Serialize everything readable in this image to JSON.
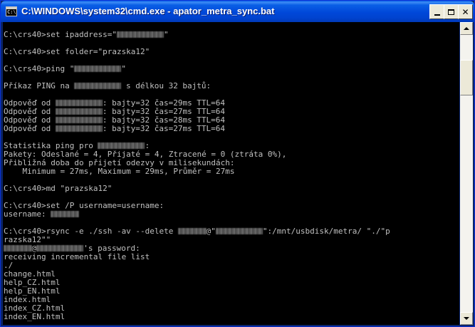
{
  "window": {
    "title": "C:\\WINDOWS\\system32\\cmd.exe - apator_metra_sync.bat",
    "app_icon": "cmd-console-icon",
    "buttons": {
      "minimize": "minimize-icon",
      "maximize": "maximize-icon",
      "close": "✕"
    }
  },
  "colors": {
    "console_bg": "#000000",
    "console_text": "#c0c0c0",
    "titlebar": "#0048d9"
  },
  "console": {
    "lines": [
      {
        "segs": []
      },
      {
        "segs": [
          {
            "t": "C:\\crs40>set ipaddress=\""
          },
          {
            "r": 10
          },
          {
            "t": "\""
          }
        ]
      },
      {
        "segs": []
      },
      {
        "segs": [
          {
            "t": "C:\\crs40>set folder=\"prazska12\""
          }
        ]
      },
      {
        "segs": []
      },
      {
        "segs": [
          {
            "t": "C:\\crs40>ping \""
          },
          {
            "r": 10
          },
          {
            "t": "\""
          }
        ]
      },
      {
        "segs": []
      },
      {
        "segs": [
          {
            "t": "Příkaz PING na "
          },
          {
            "r": 10
          },
          {
            "t": " s délkou 32 bajtů:"
          }
        ]
      },
      {
        "segs": []
      },
      {
        "segs": [
          {
            "t": "Odpověď od "
          },
          {
            "r": 10
          },
          {
            "t": ": bajty=32 čas=29ms TTL=64"
          }
        ]
      },
      {
        "segs": [
          {
            "t": "Odpověď od "
          },
          {
            "r": 10
          },
          {
            "t": ": bajty=32 čas=27ms TTL=64"
          }
        ]
      },
      {
        "segs": [
          {
            "t": "Odpověď od "
          },
          {
            "r": 10
          },
          {
            "t": ": bajty=32 čas=28ms TTL=64"
          }
        ]
      },
      {
        "segs": [
          {
            "t": "Odpověď od "
          },
          {
            "r": 10
          },
          {
            "t": ": bajty=32 čas=27ms TTL=64"
          }
        ]
      },
      {
        "segs": []
      },
      {
        "segs": [
          {
            "t": "Statistika ping pro "
          },
          {
            "r": 10
          },
          {
            "t": ":"
          }
        ]
      },
      {
        "segs": [
          {
            "t": "Pakety: Odeslané = 4, Přijaté = 4, Ztracené = 0 (ztráta 0%),"
          }
        ]
      },
      {
        "segs": [
          {
            "t": "Přibližná doba do přijetí odezvy v milisekundách:"
          }
        ]
      },
      {
        "segs": [
          {
            "t": "    Minimum = 27ms, Maximum = 29ms, Průměr = 27ms"
          }
        ]
      },
      {
        "segs": []
      },
      {
        "segs": [
          {
            "t": "C:\\crs40>md \"prazska12\""
          }
        ]
      },
      {
        "segs": []
      },
      {
        "segs": [
          {
            "t": "C:\\crs40>set /P username=username:"
          }
        ]
      },
      {
        "segs": [
          {
            "t": "username: "
          },
          {
            "r": 6
          }
        ]
      },
      {
        "segs": []
      },
      {
        "segs": [
          {
            "t": "C:\\crs40>rsync -e ./ssh -av --delete "
          },
          {
            "r": 6
          },
          {
            "t": "@\""
          },
          {
            "r": 10
          },
          {
            "t": "\":/mnt/usbdisk/metra/ \"./\"p"
          }
        ]
      },
      {
        "segs": [
          {
            "t": "razska12\"\""
          }
        ]
      },
      {
        "segs": [
          {
            "r": 6
          },
          {
            "t": "@"
          },
          {
            "r": 10
          },
          {
            "t": "'s password:"
          }
        ]
      },
      {
        "segs": [
          {
            "t": "receiving incremental file list"
          }
        ]
      },
      {
        "segs": [
          {
            "t": "./"
          }
        ]
      },
      {
        "segs": [
          {
            "t": "change.html"
          }
        ]
      },
      {
        "segs": [
          {
            "t": "help_CZ.html"
          }
        ]
      },
      {
        "segs": [
          {
            "t": "help_EN.html"
          }
        ]
      },
      {
        "segs": [
          {
            "t": "index.html"
          }
        ]
      },
      {
        "segs": [
          {
            "t": "index_CZ.html"
          }
        ]
      },
      {
        "segs": [
          {
            "t": "index_EN.html"
          }
        ]
      }
    ]
  }
}
